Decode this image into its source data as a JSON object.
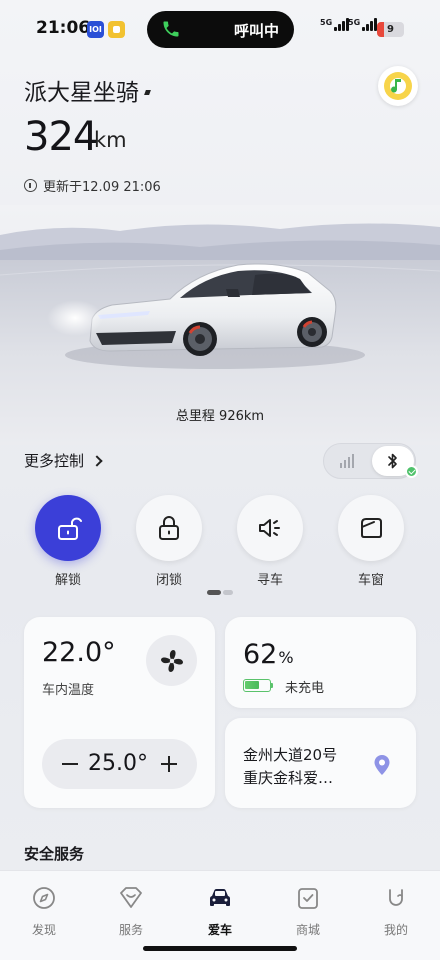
{
  "status_bar": {
    "time": "21:06",
    "island_text": "呼叫中",
    "network_1": "5G",
    "network_2": "5G",
    "battery_level": "9"
  },
  "header": {
    "car_name": "派大星坐骑",
    "range_value": "324",
    "range_unit": "km",
    "updated": "更新于12.09 21:06"
  },
  "hero": {
    "mileage": "总里程 926km"
  },
  "controls": {
    "more_label": "更多控制",
    "quick_actions": [
      {
        "label": "解锁",
        "icon": "unlock-icon",
        "active": true
      },
      {
        "label": "闭锁",
        "icon": "lock-icon",
        "active": false
      },
      {
        "label": "寻车",
        "icon": "horn-icon",
        "active": false
      },
      {
        "label": "车窗",
        "icon": "window-icon",
        "active": false
      }
    ],
    "page_index": 1,
    "page_count": 2
  },
  "climate": {
    "current_temp": "22.0°",
    "label": "车内温度",
    "target_temp": "25.0°"
  },
  "battery": {
    "percent": "62",
    "percent_unit": "%",
    "level": 0.62,
    "charge_status": "未充电"
  },
  "location": {
    "line1": "金州大道20号",
    "line2": "重庆金科爱…"
  },
  "section": {
    "safety_title": "安全服务"
  },
  "tabs": [
    {
      "label": "发现",
      "icon": "compass-icon",
      "active": false
    },
    {
      "label": "服务",
      "icon": "service-heart-icon",
      "active": false
    },
    {
      "label": "爱车",
      "icon": "car-icon",
      "active": true
    },
    {
      "label": "商城",
      "icon": "shop-icon",
      "active": false
    },
    {
      "label": "我的",
      "icon": "profile-icon",
      "active": false
    }
  ],
  "colors": {
    "accent": "#3b3fd8",
    "charge_green": "#5ac26b",
    "background": "#eceef2"
  }
}
